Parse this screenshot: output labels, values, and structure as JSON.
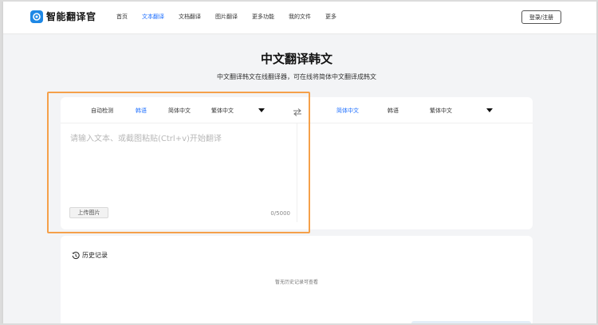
{
  "header": {
    "logo_text": "智能翻译官",
    "nav": [
      "首页",
      "文本翻译",
      "文档翻译",
      "图片翻译",
      "更多功能",
      "我的文件",
      "更多"
    ],
    "active_nav_index": 1,
    "login_label": "登录/注册"
  },
  "main": {
    "title": "中文翻译韩文",
    "subtitle": "中文翻译韩文在线翻译器，可在线将简体中文翻译成韩文"
  },
  "translator": {
    "source_langs": [
      "自动检测",
      "韩语",
      "简体中文",
      "繁体中文"
    ],
    "source_active_index": 1,
    "target_langs": [
      "简体中文",
      "韩语",
      "繁体中文"
    ],
    "target_active_index": 0,
    "input_placeholder": "请输入文本、或截图粘贴(Ctrl+v)开始翻译",
    "upload_label": "上传图片",
    "char_count": "0/5000"
  },
  "history": {
    "title": "历史记录",
    "empty_text": "暂无历史记录可查看"
  },
  "colors": {
    "accent": "#1e6fff",
    "highlight": "#f5a04a",
    "logo": "#1e88e5"
  }
}
